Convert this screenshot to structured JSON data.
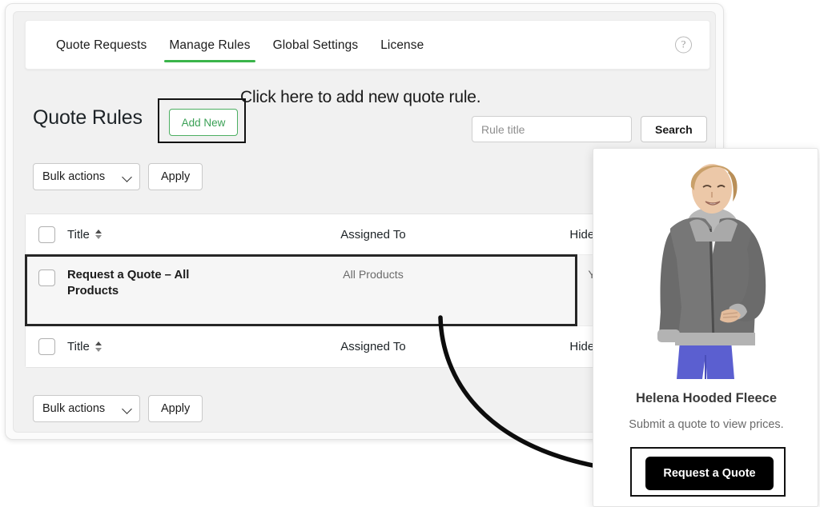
{
  "theme": {
    "accent_green": "#3ab44a",
    "add_new_green": "#3aa055",
    "annotation_black": "#111111",
    "button_black": "#000000"
  },
  "admin": {
    "tabs": [
      {
        "label": "Quote Requests",
        "active": false
      },
      {
        "label": "Manage Rules",
        "active": true
      },
      {
        "label": "Global Settings",
        "active": false
      },
      {
        "label": "License",
        "active": false
      }
    ],
    "help_icon_glyph": "?",
    "page_title": "Quote Rules",
    "add_new_label": "Add New",
    "search": {
      "placeholder": "Rule title",
      "value": "",
      "button_label": "Search"
    },
    "bulk": {
      "select_label": "Bulk actions",
      "apply_label": "Apply"
    },
    "table": {
      "columns": {
        "title": "Title",
        "assigned_to": "Assigned To",
        "hide_price": "Hide Price"
      },
      "rows": [
        {
          "title": "Request a Quote – All Products",
          "assigned_to": "All Products",
          "hide_price": "Yes"
        }
      ]
    }
  },
  "annotations": {
    "add_new_callout": "Click here to add new quote rule."
  },
  "product": {
    "name": "Helena Hooded Fleece",
    "subtitle": "Submit a quote to view prices.",
    "button_label": "Request a Quote"
  }
}
